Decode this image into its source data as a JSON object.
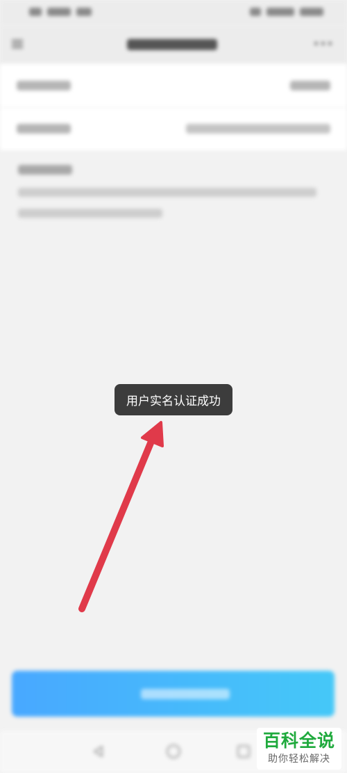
{
  "toast": {
    "message": "用户实名认证成功"
  },
  "watermark": {
    "title": "百科全说",
    "subtitle": "助你轻松解决"
  },
  "colors": {
    "background": "#f2f2f2",
    "toast_bg": "#3c3c3c",
    "button_gradient_start": "#48a8ff",
    "button_gradient_end": "#45c8f8",
    "annotation_arrow": "#e03a4a",
    "watermark_green": "#1faa3d"
  },
  "icons": {
    "header_left": "menu-icon",
    "header_right": "more-icon",
    "nav": [
      "nav-back-icon",
      "nav-home-icon",
      "nav-recent-icon"
    ]
  }
}
